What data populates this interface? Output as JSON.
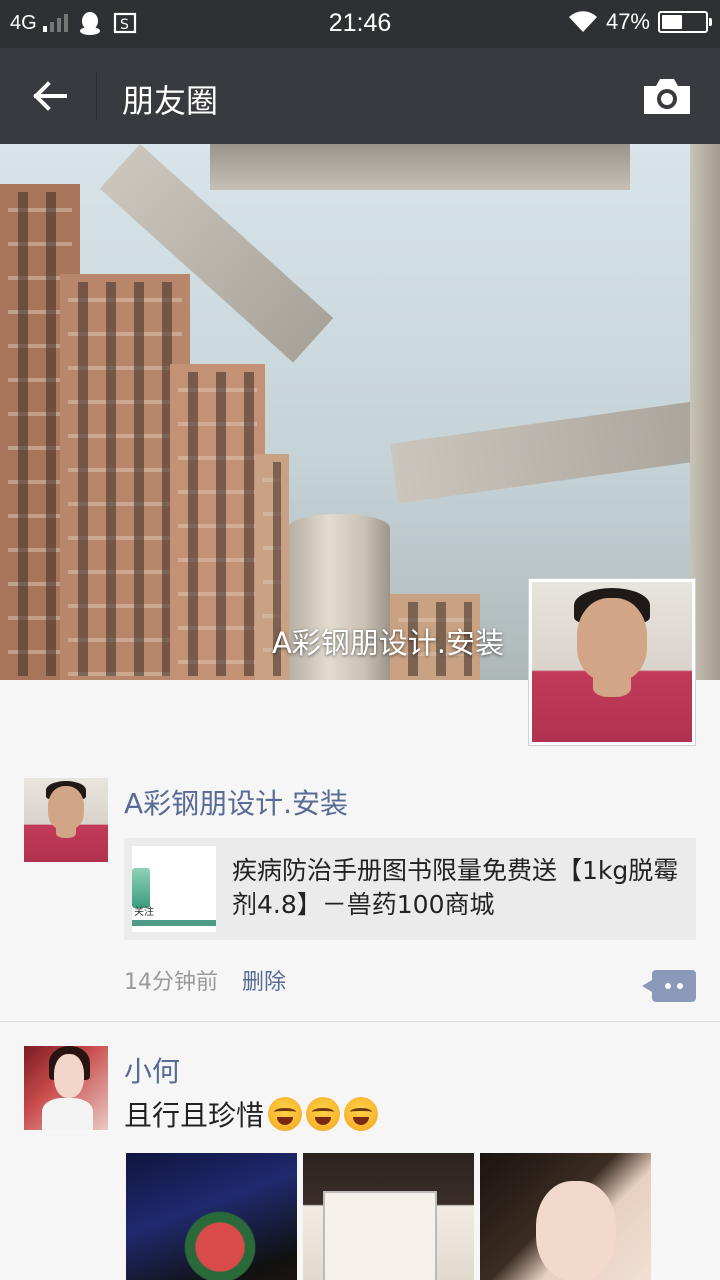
{
  "status_bar": {
    "network": "4G",
    "time": "21:46",
    "battery": "47%",
    "battery_level": 0.47
  },
  "nav": {
    "title": "朋友圈",
    "back_icon": "arrow-left-icon",
    "camera_icon": "camera-icon"
  },
  "cover": {
    "user_name": "A彩钢朋设计.安装"
  },
  "posts": [
    {
      "author": "A彩钢朋设计.安装",
      "link_title": "疾病防治手册图书限量免费送【1kg脱霉剂4.8】－兽药100商城",
      "link_thumb_text": "关注",
      "time": "14分钟前",
      "delete_label": "删除"
    },
    {
      "author": "小何",
      "text": "且行且珍惜",
      "emoji_count": 3,
      "photo_count": 3
    }
  ],
  "colors": {
    "status_bar": "#2f3034",
    "nav_bar": "#393a3f",
    "link_blue": "#576b95",
    "background": "#f6f6f6"
  }
}
